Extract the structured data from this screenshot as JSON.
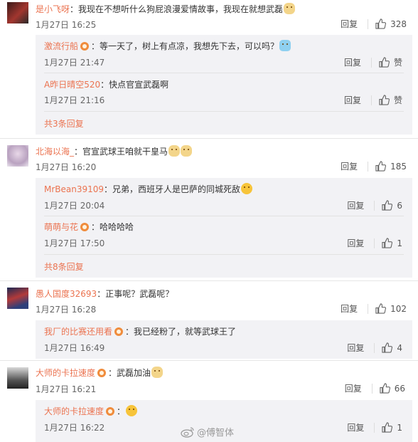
{
  "comments": [
    {
      "name": "是小飞呀",
      "text": "：我现在不想听什么狗屁浪漫爱情故事，我现在就想武磊",
      "time": "1月27日 16:25",
      "reply": "回复",
      "likes": "328",
      "replies": [
        {
          "name": "激流行船",
          "text": "：等一天了，树上有点凉，我想先下去，可以吗？",
          "time": "1月27日 21:47",
          "reply": "回复",
          "likes": "赞"
        },
        {
          "name": "A昨日晴空520",
          "text": "：快点官宣武磊啊",
          "time": "1月27日 21:16",
          "reply": "回复",
          "likes": "赞"
        }
      ],
      "more": "共3条回复"
    },
    {
      "name": "北海以海_",
      "text": "：官宣武球王咱就干皇马",
      "time": "1月27日 16:20",
      "reply": "回复",
      "likes": "185",
      "replies": [
        {
          "name": "MrBean39109",
          "text": "：兄弟，西班牙人是巴萨的同城死敌",
          "time": "1月27日 20:04",
          "reply": "回复",
          "likes": "6"
        },
        {
          "name": "萌萌与花",
          "text": "：哈哈哈哈",
          "time": "1月27日 17:50",
          "reply": "回复",
          "likes": "1"
        }
      ],
      "more": "共8条回复"
    },
    {
      "name": "愚人国度32693",
      "text": "：正事呢？武磊呢？",
      "time": "1月27日 16:28",
      "reply": "回复",
      "likes": "102",
      "replies": [
        {
          "name": "我厂的比赛还用看",
          "text": "：我已经粉了，就等武球王了",
          "time": "1月27日 16:49",
          "reply": "回复",
          "likes": "4"
        }
      ]
    },
    {
      "name": "大师的卡拉速度",
      "text": "：武磊加油",
      "time": "1月27日 16:21",
      "reply": "回复",
      "likes": "66",
      "replies": [
        {
          "name": "大师的卡拉速度",
          "text": "：",
          "time": "1月27日 16:22",
          "reply": "回复",
          "likes": "1"
        }
      ]
    }
  ],
  "watermark": "@傅智体",
  "colors": {
    "name": "#eb7350",
    "subbox": "#f2f2f5",
    "divider": "#e6e6e6"
  }
}
